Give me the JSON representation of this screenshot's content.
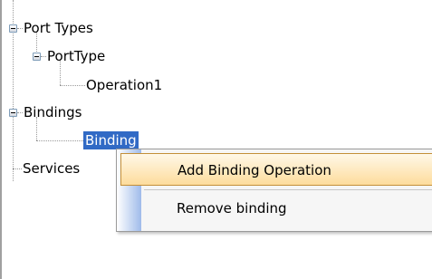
{
  "tree": {
    "nodes": [
      {
        "label": "Port Types"
      },
      {
        "label": "PortType"
      },
      {
        "label": "Operation1"
      },
      {
        "label": "Bindings"
      },
      {
        "label": "Binding"
      },
      {
        "label": "Services"
      }
    ]
  },
  "context_menu": {
    "items": [
      {
        "label": "Add Binding Operation",
        "highlighted": true
      },
      {
        "label": "Remove binding"
      }
    ]
  }
}
